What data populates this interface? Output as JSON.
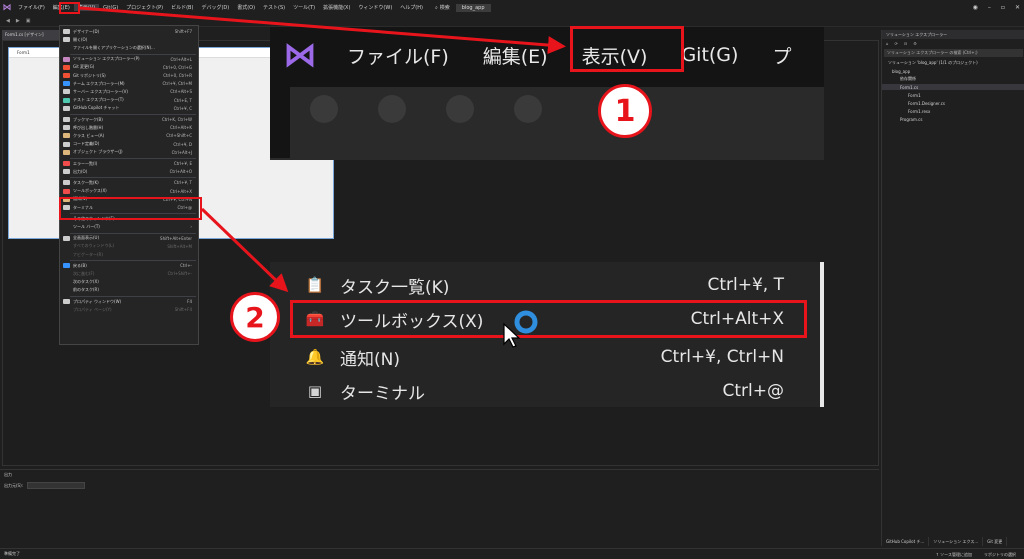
{
  "menubar": {
    "items": [
      "ファイル(F)",
      "編集(E)",
      "表示(V)",
      "Git(G)",
      "プロジェクト(P)",
      "ビルド(B)",
      "デバッグ(D)",
      "書式(O)",
      "テスト(S)",
      "ツール(T)",
      "拡張機能(X)",
      "ウィンドウ(W)",
      "ヘルプ(H)"
    ],
    "search_label": "検索",
    "solution_name": "blog_app"
  },
  "designer_tab": "Form1.cs [デザイン]",
  "form_title": "Form1",
  "view_menu": {
    "items": [
      {
        "label": "デザイナー(D)",
        "shortcut": "Shift+F7",
        "icon_color": "#cccccc"
      },
      {
        "label": "開く(O)",
        "shortcut": "",
        "icon_color": "#cccccc"
      },
      {
        "label": "ファイルを開くアプリケーションの選択(N)...",
        "shortcut": "",
        "icon_color": ""
      },
      {
        "label": "ソリューション エクスプローラー(P)",
        "shortcut": "Ctrl+Alt+L",
        "icon_color": "#c586c0"
      },
      {
        "label": "Git 変更(G)",
        "shortcut": "Ctrl+0, Ctrl+G",
        "icon_color": "#f05033"
      },
      {
        "label": "Git リポジトリ(S)",
        "shortcut": "Ctrl+0, Ctrl+R",
        "icon_color": "#f05033"
      },
      {
        "label": "チーム エクスプローラー(M)",
        "shortcut": "Ctrl+¥, Ctrl+M",
        "icon_color": "#3794ff"
      },
      {
        "label": "サーバー エクスプローラー(V)",
        "shortcut": "Ctrl+Alt+S",
        "icon_color": "#cccccc"
      },
      {
        "label": "テスト エクスプローラー(T)",
        "shortcut": "Ctrl+E, T",
        "icon_color": "#4ec9b0"
      },
      {
        "label": "GitHub Copilot チャット",
        "shortcut": "Ctrl+¥, C",
        "icon_color": "#cccccc"
      },
      {
        "label": "ブックマーク(B)",
        "shortcut": "Ctrl+K, Ctrl+W",
        "icon_color": "#cccccc"
      },
      {
        "label": "呼び出し階層(H)",
        "shortcut": "Ctrl+Alt+K",
        "icon_color": "#cccccc"
      },
      {
        "label": "クラス ビュー(A)",
        "shortcut": "Ctrl+Shift+C",
        "icon_color": "#dcb67a"
      },
      {
        "label": "コード定義(D)",
        "shortcut": "Ctrl+¥, D",
        "icon_color": "#cccccc"
      },
      {
        "label": "オブジェクト ブラウザー(J)",
        "shortcut": "Ctrl+Alt+J",
        "icon_color": "#dcb67a"
      },
      {
        "label": "エラー一覧(I)",
        "shortcut": "Ctrl+¥, E",
        "icon_color": "#f14c4c"
      },
      {
        "label": "出力(O)",
        "shortcut": "Ctrl+Alt+O",
        "icon_color": "#cccccc"
      },
      {
        "label": "タスク一覧(K)",
        "shortcut": "Ctrl+¥, T",
        "icon_color": "#cccccc"
      },
      {
        "label": "ツールボックス(X)",
        "shortcut": "Ctrl+Alt+X",
        "icon_color": "#f14c4c"
      },
      {
        "label": "通知(N)",
        "shortcut": "Ctrl+¥, Ctrl+N",
        "icon_color": "#dcb67a"
      },
      {
        "label": "ターミナル",
        "shortcut": "Ctrl+@",
        "icon_color": "#cccccc"
      },
      {
        "label": "その他のウィンドウ(E)",
        "shortcut": "›",
        "icon_color": ""
      },
      {
        "label": "ツール バー(T)",
        "shortcut": "›",
        "icon_color": ""
      },
      {
        "label": "全画面表示(U)",
        "shortcut": "Shift+Alt+Enter",
        "icon_color": "#cccccc"
      },
      {
        "label": "すべてのウィンドウ(L)",
        "shortcut": "Shift+Alt+M",
        "icon_color": "",
        "disabled": true
      },
      {
        "label": "ナビゲーター(R)",
        "shortcut": "",
        "icon_color": "",
        "disabled": true
      },
      {
        "label": "戻る(B)",
        "shortcut": "Ctrl+-",
        "icon_color": "#3794ff"
      },
      {
        "label": "次に進む(F)",
        "shortcut": "Ctrl+Shift+-",
        "icon_color": "",
        "disabled": true
      },
      {
        "label": "次のタスク(X)",
        "shortcut": "",
        "icon_color": ""
      },
      {
        "label": "前のタスク(R)",
        "shortcut": "",
        "icon_color": ""
      },
      {
        "label": "プロパティ ウィンドウ(W)",
        "shortcut": "F4",
        "icon_color": "#cccccc"
      },
      {
        "label": "プロパティ ページ(Y)",
        "shortcut": "Shift+F4",
        "icon_color": "",
        "disabled": true
      }
    ]
  },
  "zoom1": {
    "items": [
      "ファイル(F)",
      "編集(E)",
      "表示(V)",
      "Git(G)",
      "プ"
    ]
  },
  "zoom2": {
    "rows": [
      {
        "label": "タスク一覧(K)",
        "shortcut": "Ctrl+¥, T",
        "icon": "clipboard-icon",
        "glyph": "📋",
        "color": "#d4d4d4"
      },
      {
        "label": "ツールボックス(X)",
        "shortcut": "Ctrl+Alt+X",
        "icon": "toolbox-icon",
        "glyph": "🧰",
        "color": "#f14c4c"
      },
      {
        "label": "通知(N)",
        "shortcut": "Ctrl+¥, Ctrl+N",
        "icon": "bell-icon",
        "glyph": "🔔",
        "color": "#dcb67a"
      },
      {
        "label": "ターミナル",
        "shortcut": "Ctrl+@",
        "icon": "terminal-icon",
        "glyph": "▣",
        "color": "#d4d4d4"
      }
    ]
  },
  "badges": {
    "one": "1",
    "two": "2"
  },
  "solution_explorer": {
    "title": "ソリューション エクスプローラー",
    "search_placeholder": "ソリューション エクスプローラー の検索 (Ctrl+;)",
    "nodes": [
      "ソリューション 'blog_app' (1/1 のプロジェクト)",
      "blog_app",
      "依存関係",
      "Form1.cs",
      "Form1",
      "Form1.Designer.cs",
      "Form1.resx",
      "Program.cs"
    ],
    "tabs": [
      "GitHub Copilot チ...",
      "ソリューション エクス...",
      "Git 変更"
    ]
  },
  "output": {
    "title": "出力",
    "source_label": "出力元(S):"
  },
  "status": {
    "left": "準備完了",
    "add_source": "↑ ソース管理に追加",
    "select_repo": "リポジトリの選択"
  },
  "colors": {
    "highlight": "#e8141c",
    "accent": "#b180d7"
  }
}
